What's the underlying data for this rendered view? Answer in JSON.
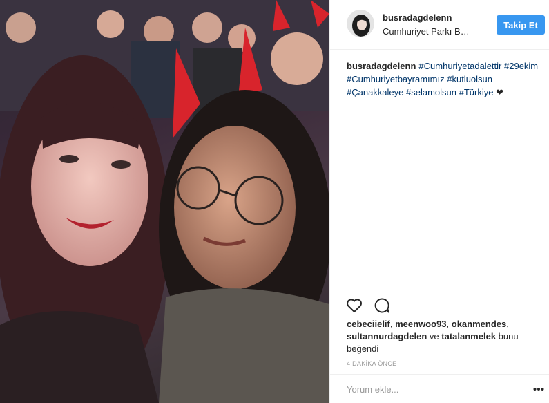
{
  "post": {
    "username": "busradagdelenn",
    "location": "Cumhuriyet Parkı Batı...",
    "follow_label": "Takip Et",
    "caption": {
      "username": "busradagdelenn",
      "tags": [
        "#Cumhuriyetadalettir",
        "#29ekim",
        "#Cumhuriyetbayramımız",
        "#kutluolsun",
        "#Çanakkaleye",
        "#selamolsun",
        "#Türkiye"
      ],
      "heart": "❤"
    },
    "likes": {
      "users": [
        "cebeciielif",
        "meenwoo93",
        "okanmendes",
        "sultannurdagdelen"
      ],
      "and_word": "ve",
      "last_user": "tatalanmelek",
      "suffix": "bunu beğendi"
    },
    "timestamp": "4 DAKİKA ÖNCE",
    "comment_placeholder": "Yorum ekle..."
  },
  "icons": {
    "like": "heart-outline-icon",
    "comment": "speech-bubble-icon",
    "more": "more-options-icon"
  },
  "colors": {
    "follow_button": "#3897f0",
    "hashtag": "#003569",
    "muted": "#999999",
    "divider": "#efefef"
  }
}
